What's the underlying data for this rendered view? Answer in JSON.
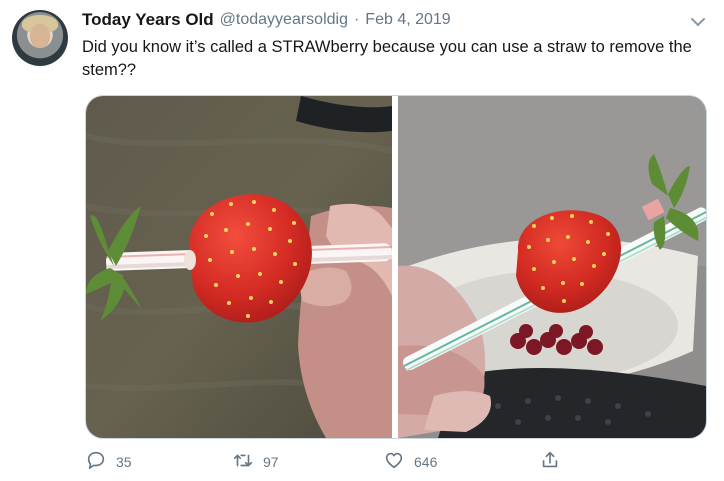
{
  "tweet": {
    "display_name": "Today Years Old",
    "handle": "@todayyearsoldig",
    "separator": "·",
    "date": "Feb 4, 2019",
    "text": "Did you know it’s called a STRAWberry because you can use a straw to remove the stem??"
  },
  "actions": {
    "reply_count": "35",
    "retweet_count": "97",
    "like_count": "646"
  },
  "icons": {
    "reply": "reply-icon",
    "retweet": "retweet-icon",
    "like": "heart-icon",
    "share": "share-icon",
    "menu": "chevron-down-icon"
  },
  "colors": {
    "text": "#14171a",
    "secondary": "#657786",
    "border": "#ccd6dd",
    "strawberry": "#d42b24"
  }
}
